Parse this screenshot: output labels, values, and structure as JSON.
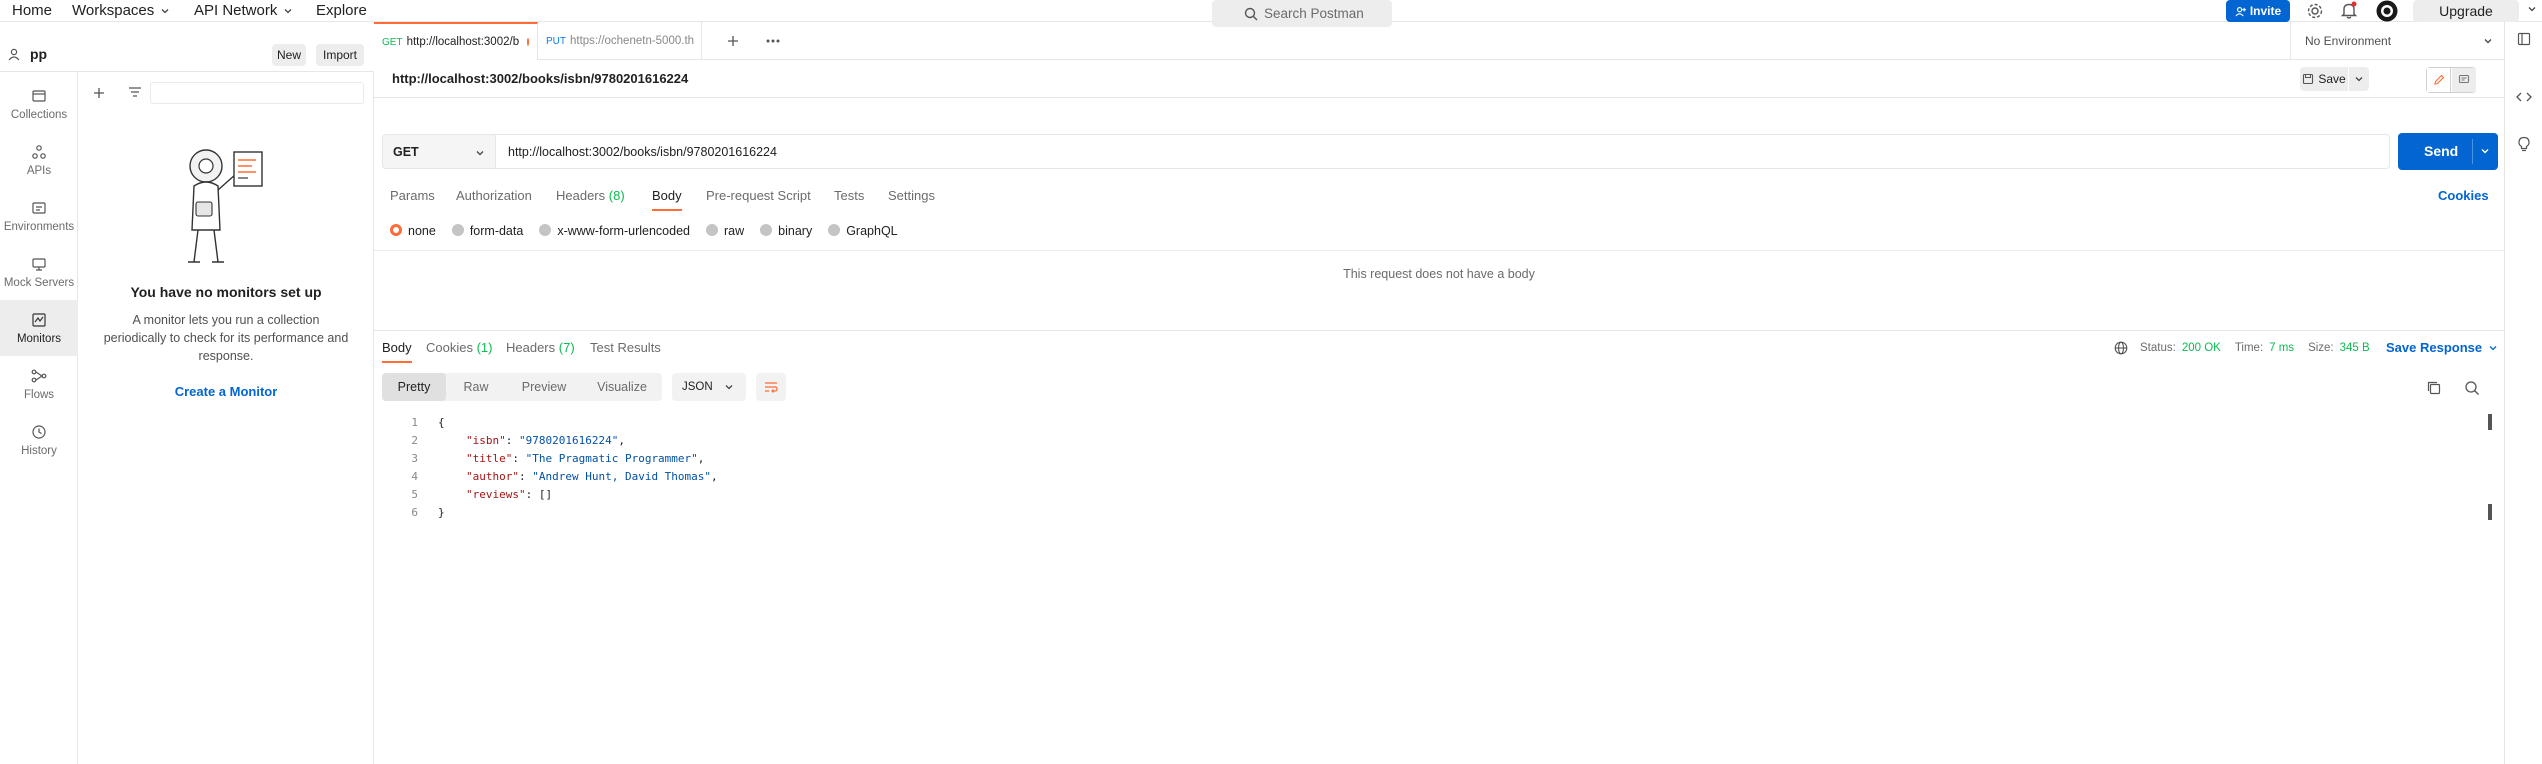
{
  "topnav": {
    "home": "Home",
    "workspaces": "Workspaces",
    "api_network": "API Network",
    "explore": "Explore",
    "search_placeholder": "Search Postman",
    "invite": "Invite",
    "upgrade": "Upgrade"
  },
  "workspace": {
    "name": "pp",
    "new_label": "New",
    "import_label": "Import"
  },
  "rail": {
    "items": [
      {
        "label": "Collections",
        "icon": "collections-icon"
      },
      {
        "label": "APIs",
        "icon": "apis-icon"
      },
      {
        "label": "Environments",
        "icon": "environments-icon"
      },
      {
        "label": "Mock Servers",
        "icon": "mock-servers-icon"
      },
      {
        "label": "Monitors",
        "icon": "monitors-icon"
      },
      {
        "label": "Flows",
        "icon": "flows-icon"
      },
      {
        "label": "History",
        "icon": "history-icon"
      }
    ],
    "active": "Monitors"
  },
  "monitors_panel": {
    "empty_title": "You have no monitors set up",
    "empty_text_1": "A monitor lets you run a collection",
    "empty_text_2": "periodically to check for its performance and",
    "empty_text_3": "response.",
    "create_link": "Create a Monitor"
  },
  "tabs": [
    {
      "method": "GET",
      "label": "http://localhost:3002/b",
      "unsaved": true
    },
    {
      "method": "PUT",
      "label": "https://ochenetn-5000.th"
    }
  ],
  "environment": {
    "selected": "No Environment"
  },
  "request": {
    "title": "http://localhost:3002/books/isbn/9780201616224",
    "save_label": "Save",
    "method": "GET",
    "url": "http://localhost:3002/books/isbn/9780201616224",
    "send_label": "Send",
    "subtabs": [
      "Params",
      "Authorization",
      "Headers",
      "Body",
      "Pre-request Script",
      "Tests",
      "Settings"
    ],
    "headers_count": "(8)",
    "active_subtab": "Body",
    "cookies_label": "Cookies",
    "body_types": [
      "none",
      "form-data",
      "x-www-form-urlencoded",
      "raw",
      "binary",
      "GraphQL"
    ],
    "selected_body_type": "none",
    "no_body_text": "This request does not have a body"
  },
  "response": {
    "tabs": [
      "Body",
      "Cookies",
      "Headers",
      "Test Results"
    ],
    "cookies_count": "(1)",
    "headers_count": "(7)",
    "status_label": "Status:",
    "status_value": "200 OK",
    "time_label": "Time:",
    "time_value": "7 ms",
    "size_label": "Size:",
    "size_value": "345 B",
    "save_response": "Save Response",
    "view_modes": [
      "Pretty",
      "Raw",
      "Preview",
      "Visualize"
    ],
    "active_view": "Pretty",
    "format": "JSON",
    "body_lines": [
      {
        "n": "1",
        "text": "{"
      },
      {
        "n": "2",
        "key": "\"isbn\"",
        "value": "\"9780201616224\"",
        "comma": ","
      },
      {
        "n": "3",
        "key": "\"title\"",
        "value": "\"The Pragmatic Programmer\"",
        "comma": ","
      },
      {
        "n": "4",
        "key": "\"author\"",
        "value": "\"Andrew Hunt, David Thomas\"",
        "comma": ","
      },
      {
        "n": "5",
        "key": "\"reviews\"",
        "value": "[]",
        "comma": ""
      },
      {
        "n": "6",
        "text": "}"
      }
    ]
  },
  "colors": {
    "accent": "#ff6c37",
    "primary": "#0265d2",
    "success": "#0cbb52"
  }
}
